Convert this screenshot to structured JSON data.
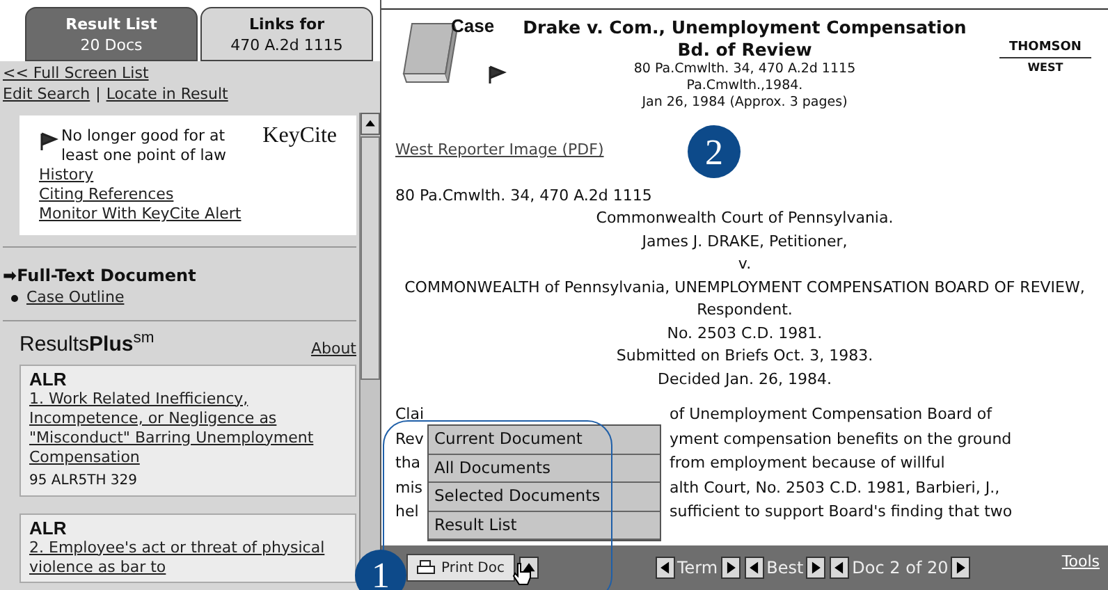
{
  "tabs": [
    {
      "line_1": "Result List",
      "line_2": "20 Docs",
      "selected": false
    },
    {
      "line_1": "Links for",
      "line_2": "470 A.2d 1115",
      "selected": true
    }
  ],
  "left_links": {
    "full_screen": "<< Full Screen List",
    "edit_search": "Edit Search",
    "separator": "|",
    "locate": "Locate in Result"
  },
  "keycite": {
    "status": "No longer good for at least one point of law",
    "logo": "KeyCite",
    "links": [
      "History",
      "Citing References",
      "Monitor With KeyCite Alert"
    ]
  },
  "full_text": {
    "marker": "➡",
    "label": "Full-Text Document",
    "items": [
      "Case Outline"
    ]
  },
  "results_plus": {
    "title": "Results**Plus**$^{sm}$",
    "about": "About",
    "cards": [
      {
        "type": "ALR",
        "link": "1. Work Related Inefficiency, Incompetence, or Negligence as \"Misconduct\" Barring Unemployment Compensation",
        "cite": "95 ALR5TH 329"
      },
      {
        "type": "ALR",
        "link": "2. Employee's act or threat of physical violence as bar to"
      }
    ]
  },
  "document": {
    "type_label": "Case",
    "title": "Drake v. Com., Unemployment Compensation Bd. of Review",
    "citation_lines": [
      "80 Pa.Cmwlth. 34, 470 A.2d 1115",
      "Pa.Cmwlth.,1984.",
      "Jan 26, 1984 (Approx. 3 pages)"
    ],
    "publisher_logo": [
      "THOMSON",
      "WEST"
    ],
    "pdf_link": "West Reporter Image (PDF)",
    "cite_line": "80 Pa.Cmwlth. 34, 470 A.2d 1115",
    "caption_lines": [
      "Commonwealth Court of Pennsylvania.",
      "James J. DRAKE, Petitioner,",
      "v.",
      "COMMONWEALTH of Pennsylvania, UNEMPLOYMENT COMPENSATION BOARD OF REVIEW,",
      "Respondent.",
      "No. 2503 C.D. 1981.",
      "Submitted on Briefs Oct. 3, 1983.",
      "Decided Jan. 26, 1984."
    ],
    "paragraph_lines": [
      {
        "left": "Clai",
        "right": "of Unemployment Compensation Board of"
      },
      {
        "left": "Rev",
        "right": "yment compensation benefits on the ground"
      },
      {
        "left": "tha",
        "right": "from employment because of willful"
      },
      {
        "left": "mis",
        "right": "alth Court, No. 2503 C.D. 1981, Barbieri, J.,"
      },
      {
        "left": "hel",
        "right": "sufficient to support Board's finding that two"
      }
    ]
  },
  "print_menu": {
    "expanded": true,
    "items": [
      "Current Document",
      "All Documents",
      "Selected Documents",
      "Result List"
    ]
  },
  "toolbar": {
    "print_button": "Print Doc",
    "nav": [
      "Term",
      "Best",
      "Doc 2 of 20"
    ],
    "tools": "Tools"
  },
  "callouts": [
    "1",
    "2"
  ]
}
